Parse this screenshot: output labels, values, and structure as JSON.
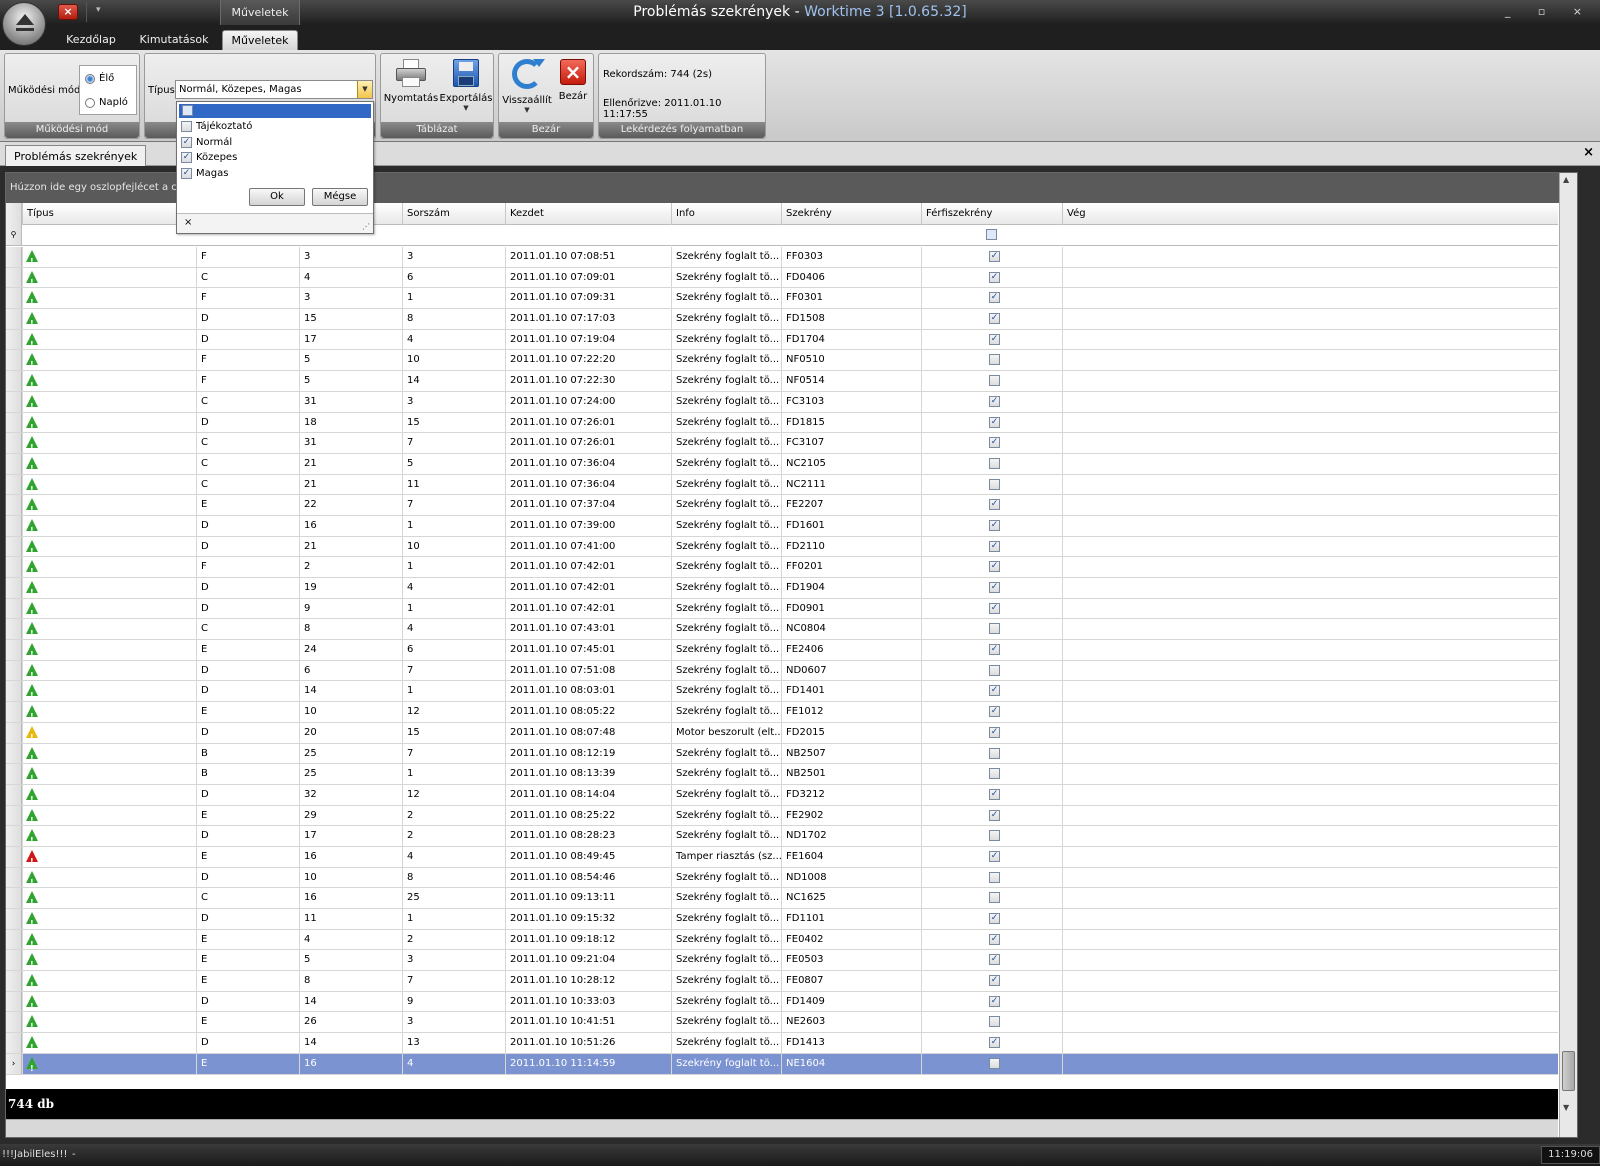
{
  "window": {
    "title_main": "Problémás szekrények - ",
    "title_app": "Worktime 3 [1.0.65.32]",
    "context_tab": "Műveletek",
    "controls": "_ ▫ ×"
  },
  "ribbon_tabs": [
    "Kezdőlap",
    "Kimutatások",
    "Műveletek"
  ],
  "ribbon": {
    "mode_group": {
      "label": "Működési mód",
      "field_label": "Működési mód",
      "options": [
        "Élő",
        "Napló"
      ],
      "selected": "Élő"
    },
    "type_group": {
      "field_label": "Típus",
      "combo_value": "Normál, Közepes, Magas"
    },
    "table_group": {
      "label": "Táblázat",
      "print": "Nyomtatás",
      "export": "Exportálás"
    },
    "close_group": {
      "label": "Bezár",
      "restore": "Visszaállít",
      "close": "Bezár"
    },
    "query_group": {
      "label": "Lekérdezés folyamatban",
      "record_count": "Rekordszám: 744 (2s)",
      "checked": "Ellenőrizve: 2011.01.10 11:17:55"
    }
  },
  "type_dropdown": {
    "items": [
      {
        "label": "Tájékoztató",
        "checked": false
      },
      {
        "label": "Normál",
        "checked": true
      },
      {
        "label": "Közepes",
        "checked": true
      },
      {
        "label": "Magas",
        "checked": true
      }
    ],
    "ok": "Ok",
    "cancel": "Mégse",
    "close": "×"
  },
  "doc_tab": "Problémás szekrények",
  "grid": {
    "group_hint": "Húzzon ide egy oszlopfejlécet a cso",
    "columns": [
      "Típus",
      "",
      "",
      "Sorszám",
      "Kezdet",
      "Info",
      "Szekrény",
      "Férfiszekrény",
      "Vég"
    ],
    "rows": [
      [
        "green",
        "F",
        "3",
        "3",
        "2011.01.10 07:08:51",
        "Szekrény foglalt tö...",
        "FF0303",
        true
      ],
      [
        "green",
        "C",
        "4",
        "6",
        "2011.01.10 07:09:01",
        "Szekrény foglalt tö...",
        "FD0406",
        true
      ],
      [
        "green",
        "F",
        "3",
        "1",
        "2011.01.10 07:09:31",
        "Szekrény foglalt tö...",
        "FF0301",
        true
      ],
      [
        "green",
        "D",
        "15",
        "8",
        "2011.01.10 07:17:03",
        "Szekrény foglalt tö...",
        "FD1508",
        true
      ],
      [
        "green",
        "D",
        "17",
        "4",
        "2011.01.10 07:19:04",
        "Szekrény foglalt tö...",
        "FD1704",
        true
      ],
      [
        "green",
        "F",
        "5",
        "10",
        "2011.01.10 07:22:20",
        "Szekrény foglalt tö...",
        "NF0510",
        false
      ],
      [
        "green",
        "F",
        "5",
        "14",
        "2011.01.10 07:22:30",
        "Szekrény foglalt tö...",
        "NF0514",
        false
      ],
      [
        "green",
        "C",
        "31",
        "3",
        "2011.01.10 07:24:00",
        "Szekrény foglalt tö...",
        "FC3103",
        true
      ],
      [
        "green",
        "D",
        "18",
        "15",
        "2011.01.10 07:26:01",
        "Szekrény foglalt tö...",
        "FD1815",
        true
      ],
      [
        "green",
        "C",
        "31",
        "7",
        "2011.01.10 07:26:01",
        "Szekrény foglalt tö...",
        "FC3107",
        true
      ],
      [
        "green",
        "C",
        "21",
        "5",
        "2011.01.10 07:36:04",
        "Szekrény foglalt tö...",
        "NC2105",
        false
      ],
      [
        "green",
        "C",
        "21",
        "11",
        "2011.01.10 07:36:04",
        "Szekrény foglalt tö...",
        "NC2111",
        false
      ],
      [
        "green",
        "E",
        "22",
        "7",
        "2011.01.10 07:37:04",
        "Szekrény foglalt tö...",
        "FE2207",
        true
      ],
      [
        "green",
        "D",
        "16",
        "1",
        "2011.01.10 07:39:00",
        "Szekrény foglalt tö...",
        "FD1601",
        true
      ],
      [
        "green",
        "D",
        "21",
        "10",
        "2011.01.10 07:41:00",
        "Szekrény foglalt tö...",
        "FD2110",
        true
      ],
      [
        "green",
        "F",
        "2",
        "1",
        "2011.01.10 07:42:01",
        "Szekrény foglalt tö...",
        "FF0201",
        true
      ],
      [
        "green",
        "D",
        "19",
        "4",
        "2011.01.10 07:42:01",
        "Szekrény foglalt tö...",
        "FD1904",
        true
      ],
      [
        "green",
        "D",
        "9",
        "1",
        "2011.01.10 07:42:01",
        "Szekrény foglalt tö...",
        "FD0901",
        true
      ],
      [
        "green",
        "C",
        "8",
        "4",
        "2011.01.10 07:43:01",
        "Szekrény foglalt tö...",
        "NC0804",
        false
      ],
      [
        "green",
        "E",
        "24",
        "6",
        "2011.01.10 07:45:01",
        "Szekrény foglalt tö...",
        "FE2406",
        true
      ],
      [
        "green",
        "D",
        "6",
        "7",
        "2011.01.10 07:51:08",
        "Szekrény foglalt tö...",
        "ND0607",
        false
      ],
      [
        "green",
        "D",
        "14",
        "1",
        "2011.01.10 08:03:01",
        "Szekrény foglalt tö...",
        "FD1401",
        true
      ],
      [
        "green",
        "E",
        "10",
        "12",
        "2011.01.10 08:05:22",
        "Szekrény foglalt tö...",
        "FE1012",
        true
      ],
      [
        "yellow",
        "D",
        "20",
        "15",
        "2011.01.10 08:07:48",
        "Motor beszorult (elt...",
        "FD2015",
        true
      ],
      [
        "green",
        "B",
        "25",
        "7",
        "2011.01.10 08:12:19",
        "Szekrény foglalt tö...",
        "NB2507",
        false
      ],
      [
        "green",
        "B",
        "25",
        "1",
        "2011.01.10 08:13:39",
        "Szekrény foglalt tö...",
        "NB2501",
        false
      ],
      [
        "green",
        "D",
        "32",
        "12",
        "2011.01.10 08:14:04",
        "Szekrény foglalt tö...",
        "FD3212",
        true
      ],
      [
        "green",
        "E",
        "29",
        "2",
        "2011.01.10 08:25:22",
        "Szekrény foglalt tö...",
        "FE2902",
        true
      ],
      [
        "green",
        "D",
        "17",
        "2",
        "2011.01.10 08:28:23",
        "Szekrény foglalt tö...",
        "ND1702",
        false
      ],
      [
        "red",
        "E",
        "16",
        "4",
        "2011.01.10 08:49:45",
        "Tamper riasztás (sz...",
        "FE1604",
        true
      ],
      [
        "green",
        "D",
        "10",
        "8",
        "2011.01.10 08:54:46",
        "Szekrény foglalt tö...",
        "ND1008",
        false
      ],
      [
        "green",
        "C",
        "16",
        "25",
        "2011.01.10 09:13:11",
        "Szekrény foglalt tö...",
        "NC1625",
        false
      ],
      [
        "green",
        "D",
        "11",
        "1",
        "2011.01.10 09:15:32",
        "Szekrény foglalt tö...",
        "FD1101",
        true
      ],
      [
        "green",
        "E",
        "4",
        "2",
        "2011.01.10 09:18:12",
        "Szekrény foglalt tö...",
        "FE0402",
        true
      ],
      [
        "green",
        "E",
        "5",
        "3",
        "2011.01.10 09:21:04",
        "Szekrény foglalt tö...",
        "FE0503",
        true
      ],
      [
        "green",
        "E",
        "8",
        "7",
        "2011.01.10 10:28:12",
        "Szekrény foglalt tö...",
        "FE0807",
        true
      ],
      [
        "green",
        "D",
        "14",
        "9",
        "2011.01.10 10:33:03",
        "Szekrény foglalt tö...",
        "FD1409",
        true
      ],
      [
        "green",
        "E",
        "26",
        "3",
        "2011.01.10 10:41:51",
        "Szekrény foglalt tö...",
        "NE2603",
        false
      ],
      [
        "green",
        "D",
        "14",
        "13",
        "2011.01.10 10:51:26",
        "Szekrény foglalt tö...",
        "FD1413",
        true
      ],
      [
        "green",
        "E",
        "16",
        "4",
        "2011.01.10 11:14:59",
        "Szekrény foglalt tö...",
        "NE1604",
        false
      ]
    ],
    "selected_row": 39,
    "footer_count": "744 db"
  },
  "statusbar": {
    "left": "!!!JabilEles!!!",
    "sep": "-",
    "time": "11:19:06"
  },
  "colors": {
    "warn_green": "#2fa52f",
    "warn_yellow": "#e8b80c",
    "warn_red": "#d01818",
    "selection": "#7b93d1"
  }
}
